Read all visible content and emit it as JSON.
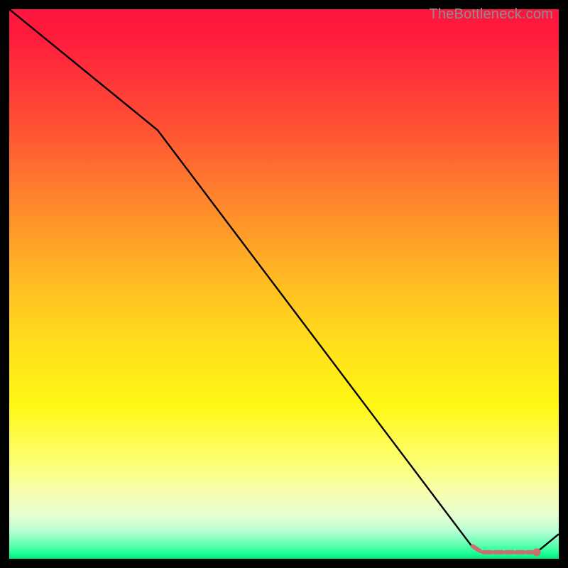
{
  "watermark": "TheBottleneck.com",
  "chart_data": {
    "type": "line",
    "title": "",
    "xlabel": "",
    "ylabel": "",
    "xlim": [
      0,
      100
    ],
    "ylim": [
      0,
      100
    ],
    "series": [
      {
        "name": "curve",
        "x": [
          0,
          27,
          84,
          86,
          96,
          100
        ],
        "y": [
          100,
          78,
          2.5,
          1.2,
          1.2,
          4.5
        ]
      }
    ],
    "dashed_segment": {
      "name": "highlight-dashes",
      "x": [
        84,
        86,
        88,
        90,
        92,
        94,
        96
      ],
      "y": [
        2.5,
        1.2,
        1.2,
        1.2,
        1.2,
        1.2,
        1.2
      ]
    },
    "end_dot": {
      "x": 96,
      "y": 1.2
    },
    "colors": {
      "curve": "#000000",
      "dashes": "#cc6e6e",
      "dot": "#cc6e6e"
    }
  }
}
